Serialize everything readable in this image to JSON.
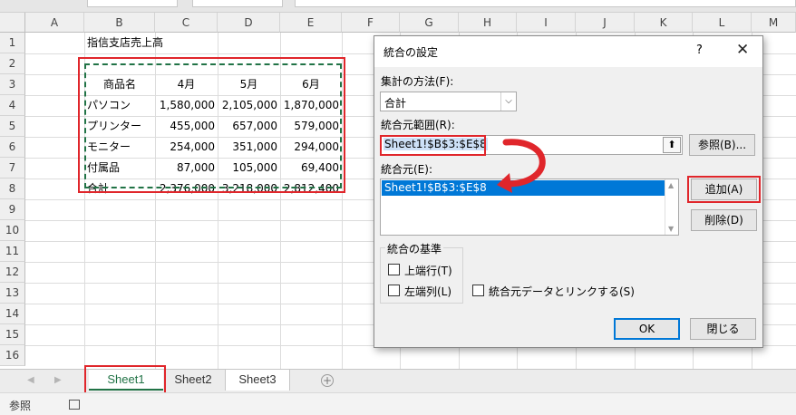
{
  "columns": [
    "A",
    "B",
    "C",
    "D",
    "E",
    "F",
    "G",
    "H",
    "I",
    "J",
    "K",
    "L",
    "M"
  ],
  "rows": [
    "1",
    "2",
    "3",
    "4",
    "5",
    "6",
    "7",
    "8",
    "9",
    "10",
    "11",
    "12",
    "13",
    "14",
    "15",
    "16"
  ],
  "sheet": {
    "b1_title": "指信支店売上高",
    "headers": [
      "商品名",
      "4月",
      "5月",
      "6月"
    ],
    "data_rows": [
      {
        "name": "パソコン",
        "apr": "1,580,000",
        "may": "2,105,000",
        "jun": "1,870,000"
      },
      {
        "name": "プリンター",
        "apr": "455,000",
        "may": "657,000",
        "jun": "579,000"
      },
      {
        "name": "モニター",
        "apr": "254,000",
        "may": "351,000",
        "jun": "294,000"
      },
      {
        "name": "付属品",
        "apr": "87,000",
        "may": "105,000",
        "jun": "69,400"
      },
      {
        "name": "合計",
        "apr": "2,376,000",
        "may": "3,218,000",
        "jun": "2,812,400"
      }
    ]
  },
  "dialog": {
    "title": "統合の設定",
    "help": "?",
    "close": "✕",
    "function_label": "集計の方法(F):",
    "function_value": "合計",
    "reference_label": "統合元範囲(R):",
    "reference_value": "Sheet1!$B$3:$E$8",
    "browse_label": "参照(B)...",
    "all_refs_label": "統合元(E):",
    "all_refs_items": [
      "Sheet1!$B$3:$E$8"
    ],
    "add_label": "追加(A)",
    "delete_label": "削除(D)",
    "use_labels_group": "統合の基準",
    "top_row_label": "上端行(T)",
    "left_column_label": "左端列(L)",
    "link_label": "統合元データとリンクする(S)",
    "ok_label": "OK",
    "close_label": "閉じる"
  },
  "tabs": [
    "Sheet1",
    "Sheet2",
    "Sheet3"
  ],
  "status": {
    "mode": "参照"
  },
  "colors": {
    "accent": "#217346",
    "highlight_red": "#e0262b",
    "selection_blue": "#0078d7"
  }
}
